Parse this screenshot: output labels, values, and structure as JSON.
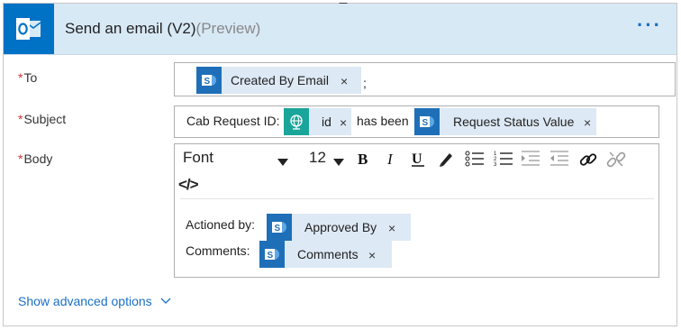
{
  "header": {
    "title": "Send an email (V2)",
    "preview": "(Preview)",
    "more_label": "···",
    "app_icon": "outlook-icon",
    "accent_color": "#0072c6",
    "header_bg": "#d8e9f6"
  },
  "fields": {
    "to": {
      "required_mark": "*",
      "label": "To",
      "token_label": "Created By Email",
      "separator": ";"
    },
    "subject": {
      "required_mark": "*",
      "label": "Subject",
      "prefix_text": "Cab Request ID:",
      "token1_label": "id",
      "middle_text": "has been",
      "token2_label": "Request Status Value"
    },
    "body": {
      "required_mark": "*",
      "label": "Body",
      "font_select": "Font",
      "size_select": "12",
      "code_view_label": "</>",
      "line1_label": "Actioned by:",
      "line1_token": "Approved By",
      "line2_label": "Comments:",
      "line2_token": "Comments"
    }
  },
  "token_close": "×",
  "advanced_options_label": "Show advanced options"
}
